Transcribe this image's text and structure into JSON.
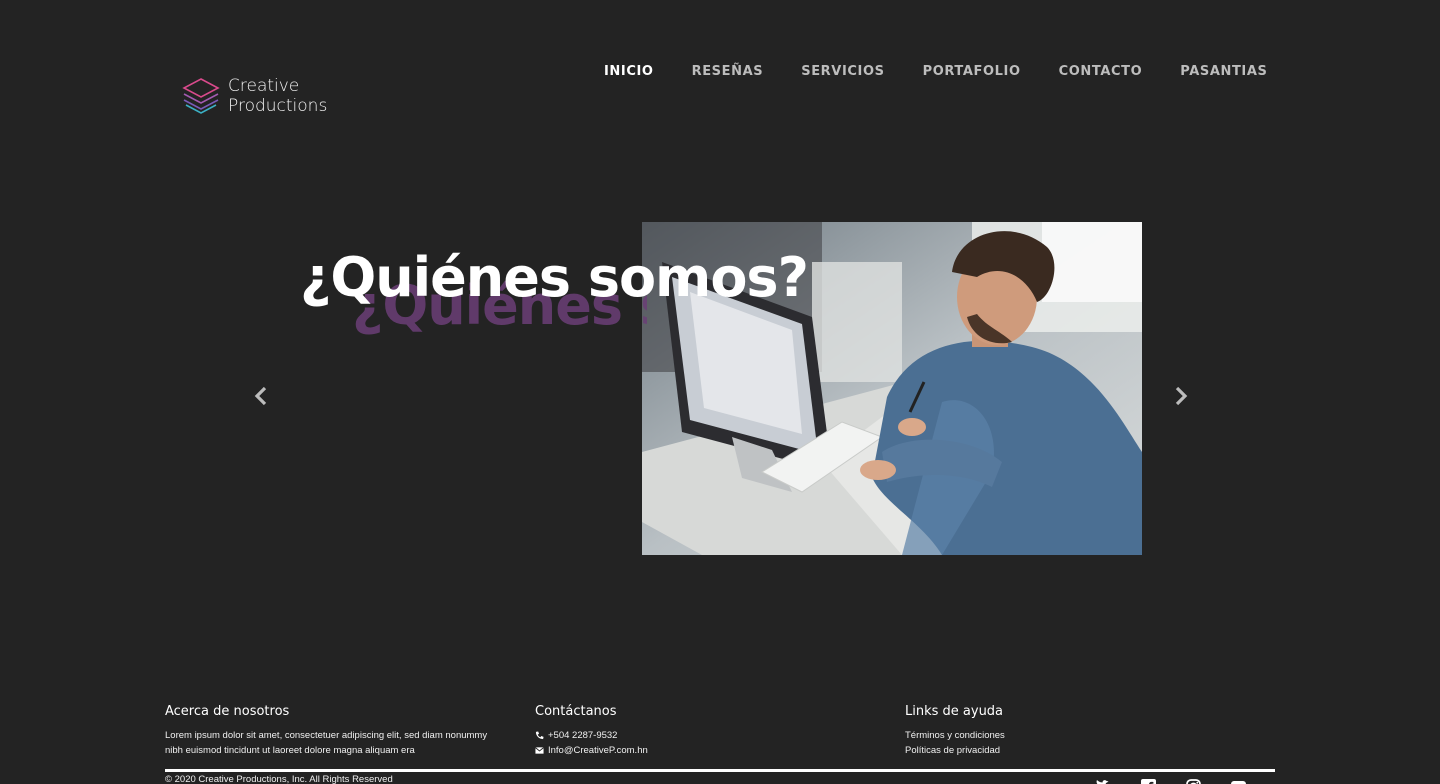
{
  "brand": {
    "line1": "Creative",
    "line2": "Productions",
    "colors": {
      "pink": "#d94a8c",
      "purple": "#7a5ab8",
      "teal": "#3bb0c4"
    }
  },
  "nav": {
    "items": [
      {
        "label": "INICIO",
        "active": true
      },
      {
        "label": "RESEÑAS",
        "active": false
      },
      {
        "label": "SERVICIOS",
        "active": false
      },
      {
        "label": "PORTAFOLIO",
        "active": false
      },
      {
        "label": "CONTACTO",
        "active": false
      },
      {
        "label": "PASANTIAS",
        "active": false
      }
    ]
  },
  "carousel": {
    "headline": "¿Quiénes somos?",
    "headline_shadow": "¿Quiénes somos?",
    "shadow_color": "#6b3f77",
    "prev_icon": "chevron-left-icon",
    "next_icon": "chevron-right-icon"
  },
  "footer": {
    "about": {
      "title": "Acerca de nosotros",
      "line1": "Lorem ipsum dolor sit amet, consectetuer adipiscing elit, sed diam nonummy",
      "line2": "nibh euismod tincidunt ut laoreet dolore magna aliquam era"
    },
    "contact": {
      "title": "Contáctanos",
      "phone": "+504 2287-9532",
      "email": "Info@CreativeP.com.hn"
    },
    "help": {
      "title": "Links de ayuda",
      "terms": "Términos y condiciones",
      "privacy": "Políticas de privacidad"
    },
    "copyright": "© 2020 Creative Productions, Inc. All Rights Reserved",
    "socials": [
      "twitter-icon",
      "facebook-icon",
      "instagram-icon",
      "youtube-icon"
    ]
  }
}
